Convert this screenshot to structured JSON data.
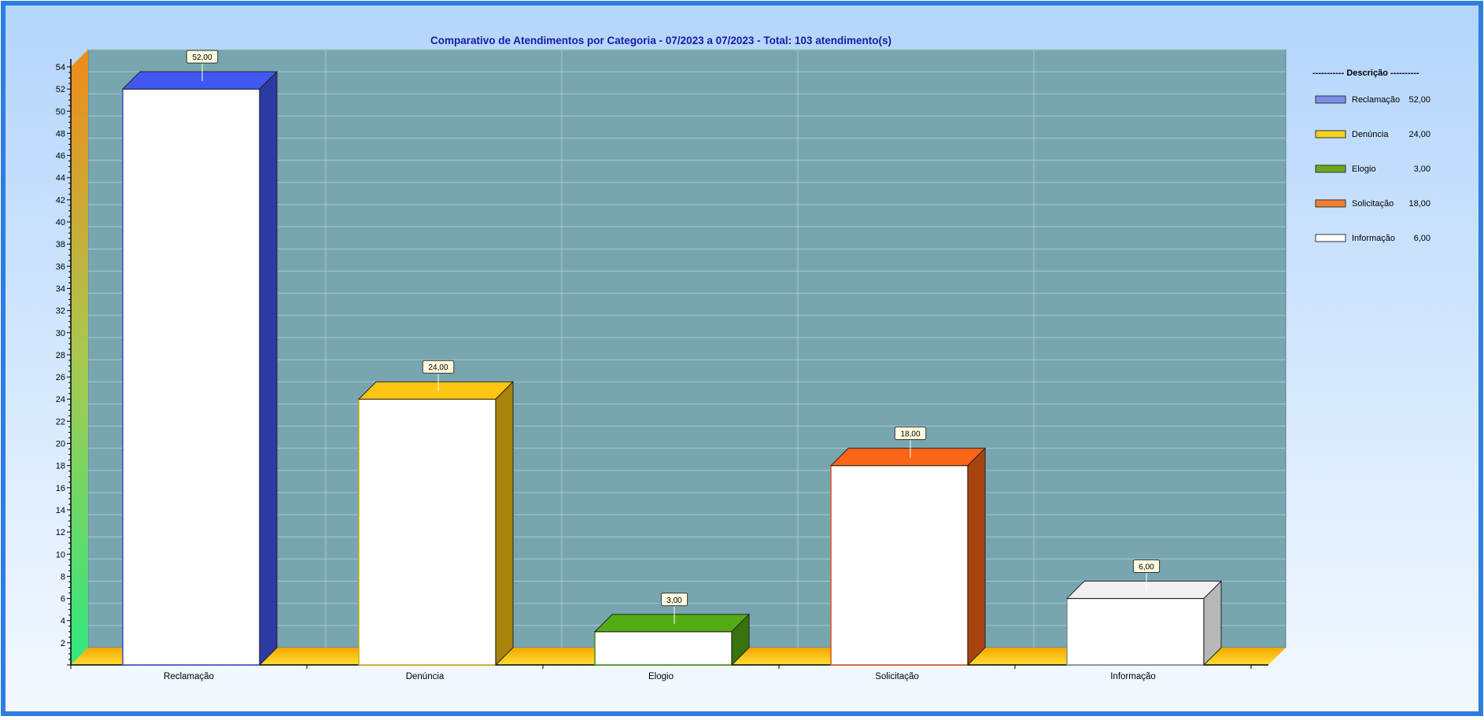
{
  "chart_data": {
    "type": "bar",
    "title": "Comparativo de Atendimentos por Categoria - 07/2023 a 07/2023 - Total: 103 atendimento(s)",
    "categories": [
      "Reclamação",
      "Denúncia",
      "Elogio",
      "Solicitação",
      "Informação"
    ],
    "values": [
      52,
      24,
      3,
      18,
      6
    ],
    "value_labels": [
      "52,00",
      "24,00",
      "3,00",
      "18,00",
      "6,00"
    ],
    "colors": [
      "#3a4fd6",
      "#e0b010",
      "#4a9a10",
      "#e05a14",
      "#ffffff"
    ],
    "ylim": [
      0,
      54
    ],
    "yticks": [
      2,
      4,
      6,
      8,
      10,
      12,
      14,
      16,
      18,
      20,
      22,
      24,
      26,
      28,
      30,
      32,
      34,
      36,
      38,
      40,
      42,
      44,
      46,
      48,
      50,
      52,
      54
    ],
    "grid": true,
    "three_d": true,
    "xlabel": "",
    "ylabel": "",
    "legend": {
      "position": "right",
      "title": "----------- Descrição ----------",
      "entries": [
        {
          "label": "Reclamação",
          "value": "52,00",
          "color": "#7b8fe8"
        },
        {
          "label": "Denúncia",
          "value": "24,00",
          "color": "#f5d020"
        },
        {
          "label": "Elogio",
          "value": "3,00",
          "color": "#6aa81e"
        },
        {
          "label": "Solicitação",
          "value": "18,00",
          "color": "#f08030"
        },
        {
          "label": "Informação",
          "value": "6,00",
          "color": "#ffffff"
        }
      ]
    }
  },
  "colors": {
    "frame_border": "#2f7de0",
    "background_top": "#b8d8fb",
    "plot_bg": "#7aa8b0",
    "floor": "#f5c000",
    "title": "#1a1aa8"
  }
}
